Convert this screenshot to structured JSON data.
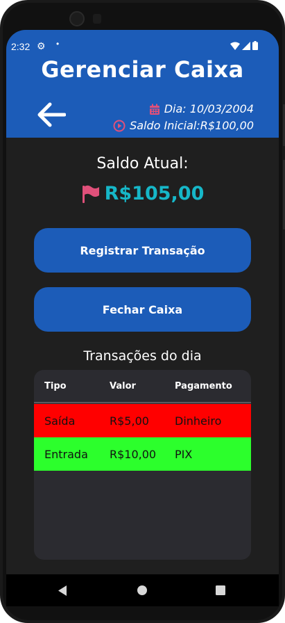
{
  "status_bar": {
    "time": "2:32",
    "icons": [
      "gear-icon",
      "dot-icon",
      "wifi-icon",
      "signal-icon",
      "battery-icon"
    ]
  },
  "header": {
    "title": "Gerenciar Caixa",
    "date_text": "Dia: 10/03/2004",
    "initial_balance_text": "Saldo Inicial:R$100,00",
    "color": "#1c5cb8"
  },
  "balance": {
    "label": "Saldo Atual:",
    "value": "R$105,00",
    "value_color": "#16b7c8",
    "flag_color": "#e0507a"
  },
  "buttons": {
    "register": "Registrar Transação",
    "close": "Fechar Caixa"
  },
  "transactions": {
    "title": "Transações do dia",
    "columns": [
      "Tipo",
      "Valor",
      "Pagamento"
    ],
    "rows": [
      {
        "tipo": "Saída",
        "valor": "R$5,00",
        "pagamento": "Dinheiro",
        "color": "#ff0000"
      },
      {
        "tipo": "Entrada",
        "valor": "R$10,00",
        "pagamento": "PIX",
        "color": "#2cff2c"
      }
    ]
  },
  "nav_bar": {
    "back": "nav-back-icon",
    "home": "nav-home-icon",
    "recents": "nav-recents-icon"
  }
}
